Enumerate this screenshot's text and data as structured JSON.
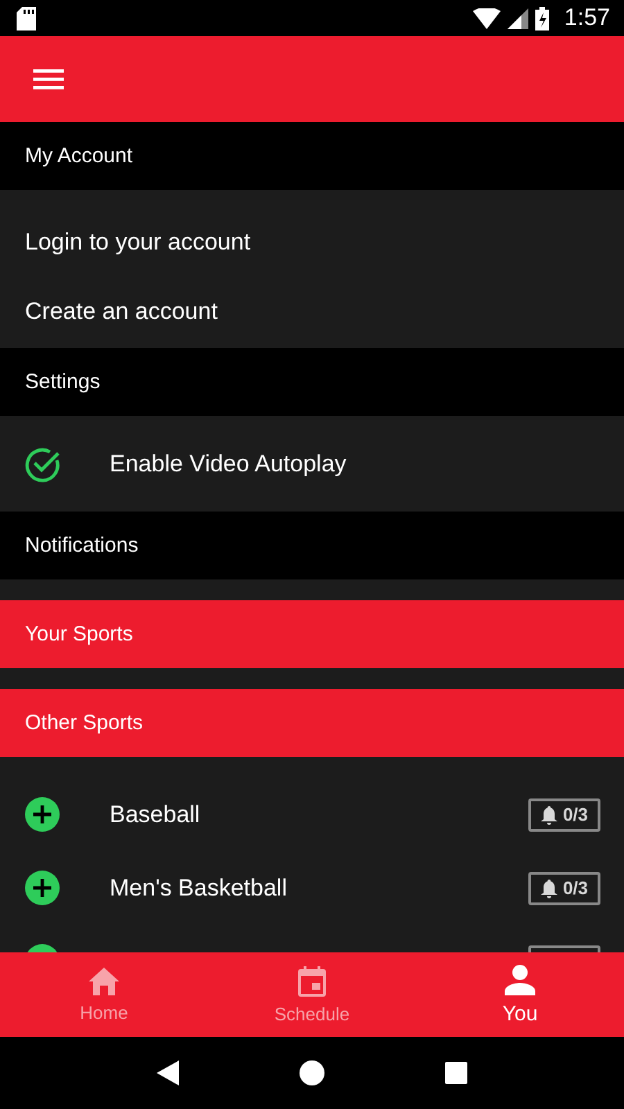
{
  "status_bar": {
    "time": "1:57"
  },
  "sections": [
    {
      "kind": "header",
      "title": "My Account"
    },
    {
      "kind": "links",
      "items": [
        {
          "label": "Login to your account"
        },
        {
          "label": "Create an account"
        }
      ]
    },
    {
      "kind": "header",
      "title": "Settings"
    },
    {
      "kind": "toggle",
      "label": "Enable Video Autoplay",
      "checked": true
    },
    {
      "kind": "header",
      "title": "Notifications"
    },
    {
      "kind": "red_header",
      "title": "Your Sports"
    },
    {
      "kind": "red_header",
      "title": "Other Sports"
    },
    {
      "kind": "sports",
      "items": [
        {
          "kind": "sport",
          "name": "Baseball",
          "alerts": "0/3"
        },
        {
          "kind": "sport",
          "name": "Men's Basketball",
          "alerts": "0/3"
        },
        {
          "kind": "partial"
        }
      ]
    }
  ],
  "tabs": [
    {
      "label": "Home",
      "kind": "home",
      "selected": false
    },
    {
      "label": "Schedule",
      "kind": "calendar",
      "selected": false
    },
    {
      "label": "You",
      "kind": "person",
      "selected": true
    }
  ]
}
